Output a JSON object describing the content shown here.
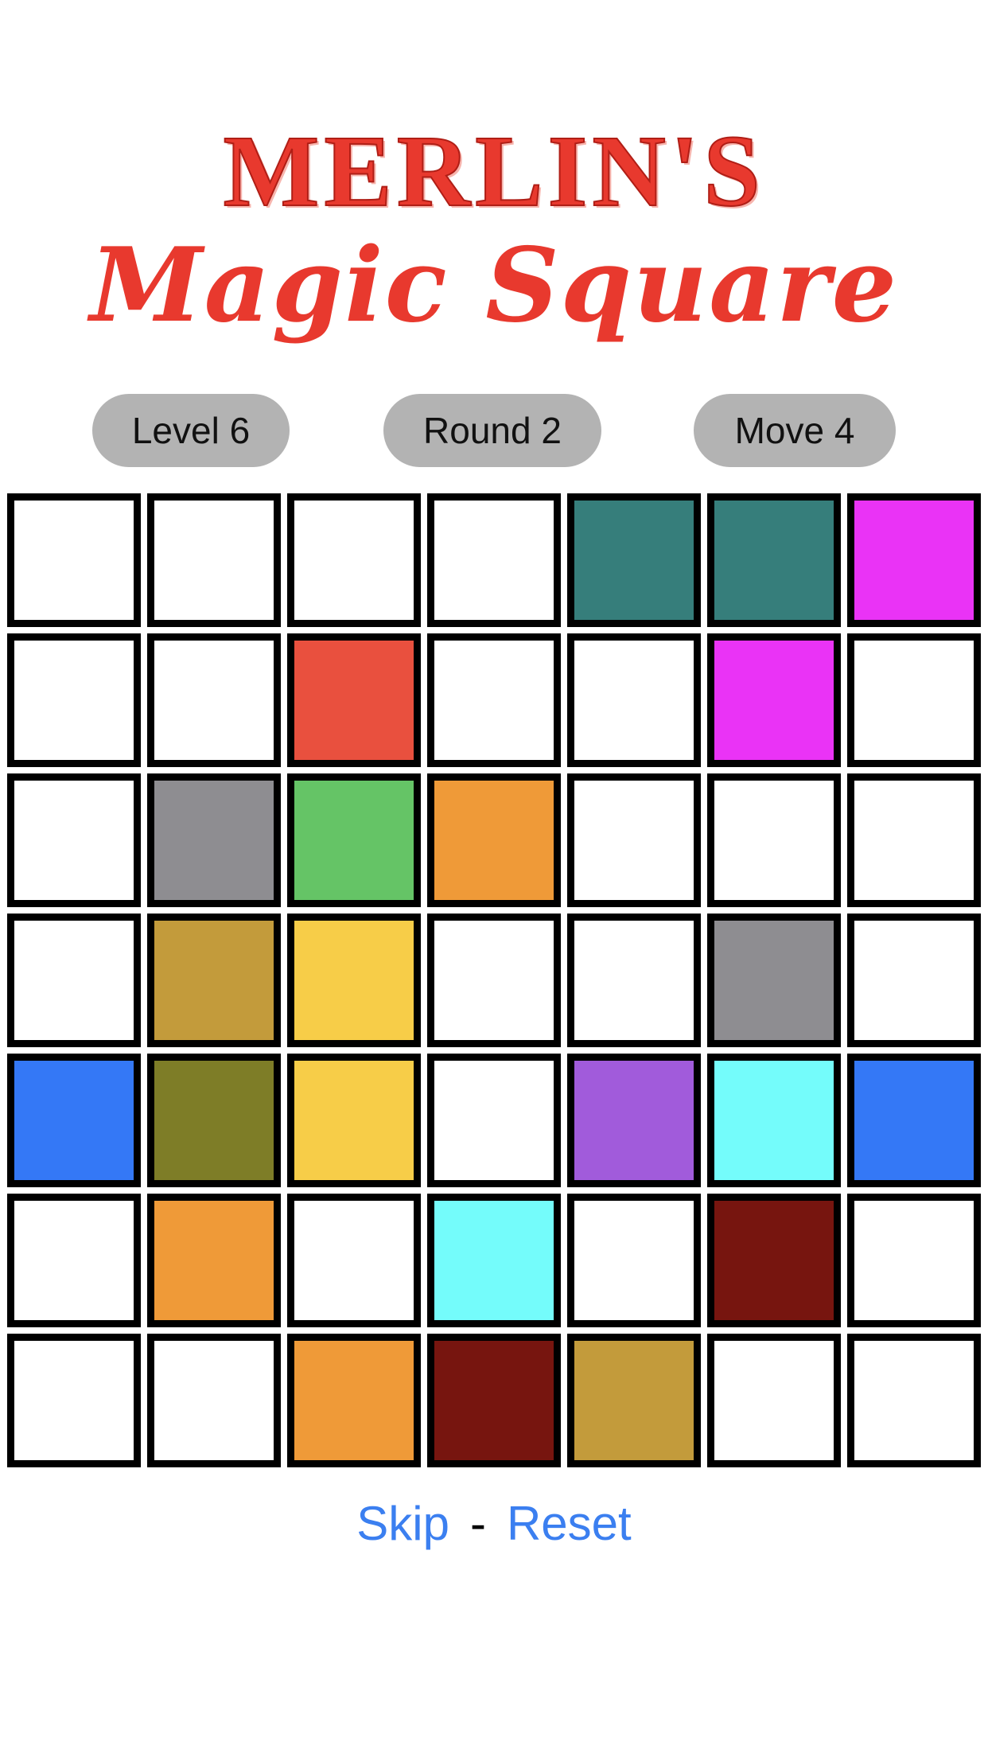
{
  "title": {
    "line1": "MERLIN'S",
    "line2": "Magic Square",
    "color": "#e8392e"
  },
  "status": {
    "level": "Level 6",
    "round": "Round 2",
    "move": "Move 4"
  },
  "colors": {
    "white": "#ffffff",
    "teal": "#367e7b",
    "magenta": "#ea33f6",
    "red": "#e9503e",
    "gray": "#8e8d91",
    "green": "#65c466",
    "orange": "#ef9a38",
    "gold": "#c39b3b",
    "yellow": "#f7cd48",
    "blue": "#3478f6",
    "olive": "#7e7d27",
    "purple": "#a15bdb",
    "cyan": "#74fcfb",
    "maroon": "#77150f"
  },
  "board": {
    "rows": 7,
    "cols": 7,
    "cells": [
      [
        "white",
        "white",
        "white",
        "white",
        "teal",
        "teal",
        "magenta"
      ],
      [
        "white",
        "white",
        "red",
        "white",
        "white",
        "magenta",
        "white"
      ],
      [
        "white",
        "gray",
        "green",
        "orange",
        "white",
        "white",
        "white"
      ],
      [
        "white",
        "gold",
        "yellow",
        "white",
        "white",
        "gray",
        "white"
      ],
      [
        "blue",
        "olive",
        "yellow",
        "white",
        "purple",
        "cyan",
        "blue"
      ],
      [
        "white",
        "orange",
        "white",
        "cyan",
        "white",
        "maroon",
        "white"
      ],
      [
        "white",
        "white",
        "orange",
        "maroon",
        "gold",
        "white",
        "white"
      ]
    ]
  },
  "footer": {
    "skip": "Skip",
    "separator": "-",
    "reset": "Reset"
  }
}
